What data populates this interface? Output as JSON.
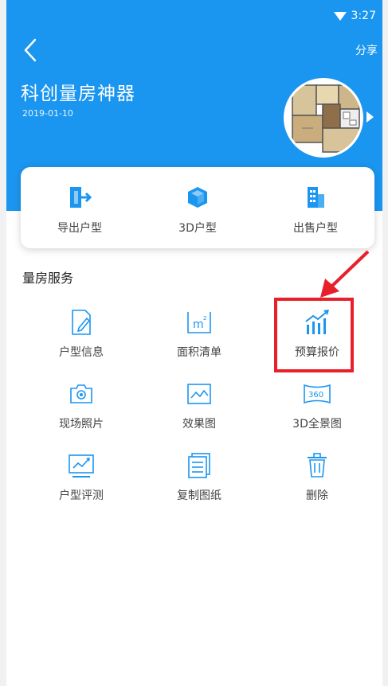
{
  "status": {
    "time": "3:27"
  },
  "header": {
    "share_label": "分享",
    "title": "科创量房神器",
    "date": "2019-01-10"
  },
  "quick_actions": [
    {
      "label": "导出户型",
      "icon": "export-icon"
    },
    {
      "label": "3D户型",
      "icon": "cube-3d-icon"
    },
    {
      "label": "出售户型",
      "icon": "building-icon"
    }
  ],
  "services": {
    "section_title": "量房服务",
    "items": [
      {
        "label": "户型信息",
        "icon": "edit-document-icon"
      },
      {
        "label": "面积清单",
        "icon": "square-meter-icon"
      },
      {
        "label": "预算报价",
        "icon": "bar-chart-trend-icon"
      },
      {
        "label": "现场照片",
        "icon": "camera-icon"
      },
      {
        "label": "效果图",
        "icon": "picture-icon"
      },
      {
        "label": "3D全景图",
        "icon": "panorama-360-icon"
      },
      {
        "label": "户型评测",
        "icon": "chart-monitor-icon"
      },
      {
        "label": "复制图纸",
        "icon": "copy-document-icon"
      },
      {
        "label": "删除",
        "icon": "trash-icon"
      }
    ]
  },
  "colors": {
    "brand_blue": "#1b96f0",
    "highlight_red": "#e8202a"
  }
}
